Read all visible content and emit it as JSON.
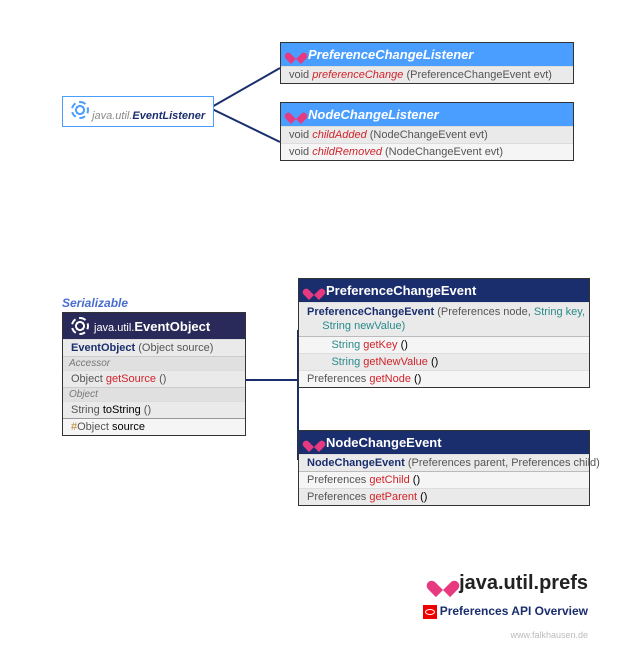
{
  "eventListener": {
    "prefix": "java.util.",
    "name": "EventListener"
  },
  "serializable": "Serializable",
  "pcl": {
    "title": "PreferenceChangeListener",
    "m1": {
      "ret": "void",
      "name": "preferenceChange",
      "params": "(PreferenceChangeEvent evt)"
    }
  },
  "ncl": {
    "title": "NodeChangeListener",
    "m1": {
      "ret": "void",
      "name": "childAdded",
      "params": "(NodeChangeEvent evt)"
    },
    "m2": {
      "ret": "void",
      "name": "childRemoved",
      "params": "(NodeChangeEvent evt)"
    }
  },
  "evo": {
    "prefix": "java.util.",
    "title": "EventObject",
    "ctor": {
      "name": "EventObject",
      "params": "(Object source)"
    },
    "acc": "Accessor",
    "m1": {
      "ret": "Object",
      "name": "getSource",
      "params": "()"
    },
    "obj": "Object",
    "m2": {
      "ret": "String",
      "name": "toString",
      "params": "()"
    },
    "field": {
      "hash": "#",
      "type": "Object",
      "name": "source"
    }
  },
  "pce": {
    "title": "PreferenceChangeEvent",
    "ctor": {
      "name": "PreferenceChangeEvent",
      "p1": "(Preferences node,",
      "p2": "String key,",
      "p3": "String newValue)"
    },
    "m1": {
      "ret": "String",
      "name": "getKey",
      "params": "()"
    },
    "m2": {
      "ret": "String",
      "name": "getNewValue",
      "params": "()"
    },
    "m3": {
      "ret": "Preferences",
      "name": "getNode",
      "params": "()"
    }
  },
  "nce": {
    "title": "NodeChangeEvent",
    "ctor": {
      "name": "NodeChangeEvent",
      "params": "(Preferences parent, Preferences child)"
    },
    "m1": {
      "ret": "Preferences",
      "name": "getChild",
      "params": "()"
    },
    "m2": {
      "ret": "Preferences",
      "name": "getParent",
      "params": "()"
    }
  },
  "pkg": "java.util.prefs",
  "overview": "Preferences API Overview",
  "credit": "www.falkhausen.de"
}
